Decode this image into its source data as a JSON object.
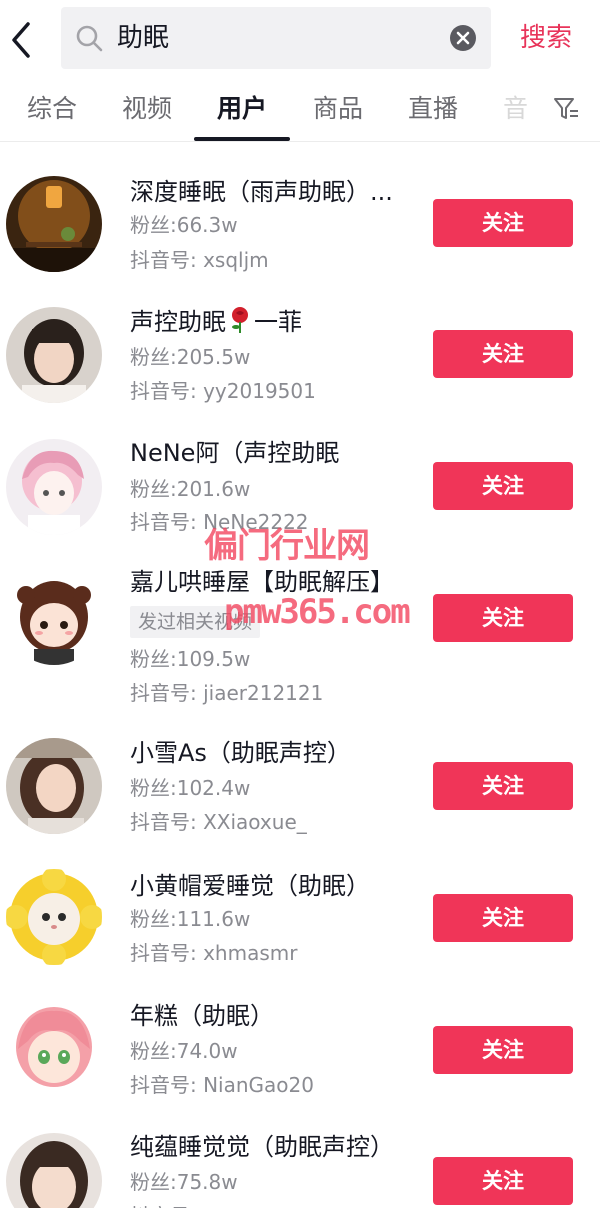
{
  "search": {
    "query": "助眠",
    "submit_label": "搜索"
  },
  "tabs": [
    {
      "label": "综合",
      "active": false
    },
    {
      "label": "视频",
      "active": false
    },
    {
      "label": "用户",
      "active": true
    },
    {
      "label": "商品",
      "active": false
    },
    {
      "label": "直播",
      "active": false
    },
    {
      "label": "音",
      "active": false
    }
  ],
  "follow_label": "关注",
  "users": [
    {
      "name": "深度睡眠（雨声助眠）...",
      "fans": "粉丝:66.3w",
      "douyin_id": "抖音号: xsqljm"
    },
    {
      "name_before": "声控助眠",
      "name_after": "一菲",
      "name_icon": "rose-emoji",
      "fans": "粉丝:205.5w",
      "douyin_id": "抖音号: yy2019501"
    },
    {
      "name": "NeNe阿（声控助眠",
      "fans": "粉丝:201.6w",
      "douyin_id": "抖音号: NeNe2222"
    },
    {
      "name": "嘉儿哄睡屋【助眠解压】",
      "tag": "发过相关视频",
      "fans": "粉丝:109.5w",
      "douyin_id": "抖音号: jiaer212121"
    },
    {
      "name": "小雪As（助眠声控）",
      "fans": "粉丝:102.4w",
      "douyin_id": "抖音号: XXiaoxue_"
    },
    {
      "name": "小黄帽爱睡觉（助眠）",
      "fans": "粉丝:111.6w",
      "douyin_id": "抖音号: xhmasmr"
    },
    {
      "name": "年糕（助眠）",
      "fans": "粉丝:74.0w",
      "douyin_id": "抖音号: NianGao20"
    },
    {
      "name": "纯蕴睡觉觉（助眠声控）",
      "fans": "粉丝:75.8w",
      "douyin_id": "抖音号: "
    }
  ],
  "watermark": {
    "line1": "偏门行业网",
    "line2": "pmw365.com"
  },
  "colors": {
    "accent": "#f03558",
    "search_label": "#e8345a",
    "secondary_text": "#8a8b91",
    "search_bg": "#f1f1f3"
  }
}
